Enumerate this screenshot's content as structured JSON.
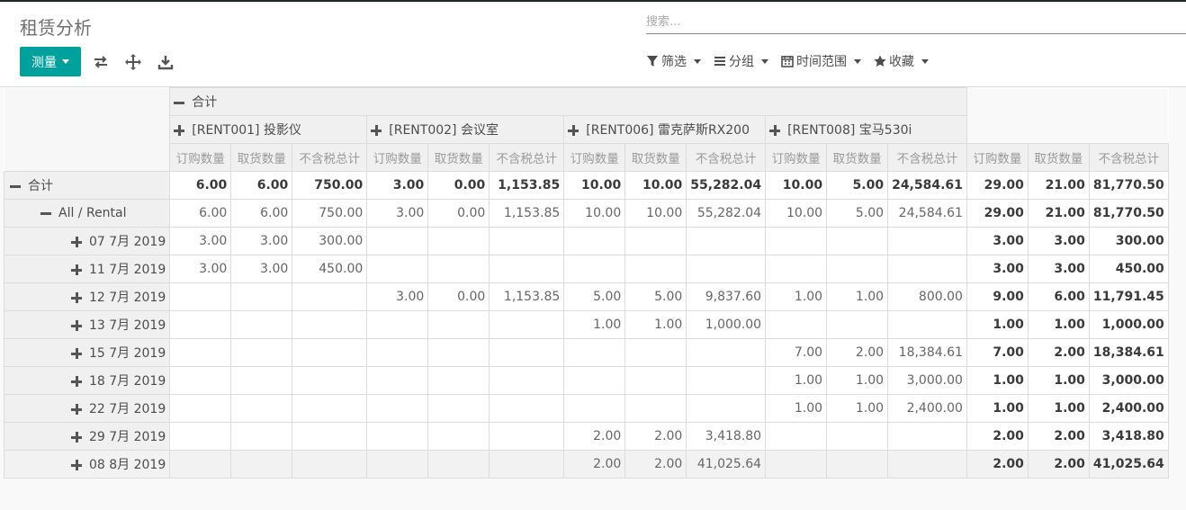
{
  "title": "租赁分析",
  "search": {
    "placeholder": "搜索..."
  },
  "toolbar": {
    "measure_label": "测量",
    "icons": [
      "flip-axis-icon",
      "expand-all-icon",
      "download-icon"
    ]
  },
  "filters": [
    {
      "label": "筛选",
      "icon": "filter-icon"
    },
    {
      "label": "分组",
      "icon": "group-icon"
    },
    {
      "label": "时间范围",
      "icon": "calendar-icon"
    },
    {
      "label": "收藏",
      "icon": "star-icon"
    }
  ],
  "pivot": {
    "col_total_label": "合计",
    "products": [
      "[RENT001] 投影仪",
      "[RENT002] 会议室",
      "[RENT006] 雷克萨斯RX200",
      "[RENT008] 宝马530i"
    ],
    "measures": [
      "订购数量",
      "取货数量",
      "不含税总计"
    ],
    "rows": [
      {
        "label": "合计",
        "level": 0,
        "sign": "minus",
        "cells": [
          "6.00",
          "6.00",
          "750.00",
          "3.00",
          "0.00",
          "1,153.85",
          "10.00",
          "10.00",
          "55,282.04",
          "10.00",
          "5.00",
          "24,584.61",
          "29.00",
          "21.00",
          "81,770.50"
        ]
      },
      {
        "label": "All / Rental",
        "level": 1,
        "sign": "minus",
        "cells": [
          "6.00",
          "6.00",
          "750.00",
          "3.00",
          "0.00",
          "1,153.85",
          "10.00",
          "10.00",
          "55,282.04",
          "10.00",
          "5.00",
          "24,584.61",
          "29.00",
          "21.00",
          "81,770.50"
        ]
      },
      {
        "label": "07 7月 2019",
        "level": 2,
        "sign": "plus",
        "cells": [
          "3.00",
          "3.00",
          "300.00",
          "",
          "",
          "",
          "",
          "",
          "",
          "",
          "",
          "",
          "3.00",
          "3.00",
          "300.00"
        ]
      },
      {
        "label": "11 7月 2019",
        "level": 2,
        "sign": "plus",
        "cells": [
          "3.00",
          "3.00",
          "450.00",
          "",
          "",
          "",
          "",
          "",
          "",
          "",
          "",
          "",
          "3.00",
          "3.00",
          "450.00"
        ]
      },
      {
        "label": "12 7月 2019",
        "level": 2,
        "sign": "plus",
        "cells": [
          "",
          "",
          "",
          "3.00",
          "0.00",
          "1,153.85",
          "5.00",
          "5.00",
          "9,837.60",
          "1.00",
          "1.00",
          "800.00",
          "9.00",
          "6.00",
          "11,791.45"
        ]
      },
      {
        "label": "13 7月 2019",
        "level": 2,
        "sign": "plus",
        "cells": [
          "",
          "",
          "",
          "",
          "",
          "",
          "1.00",
          "1.00",
          "1,000.00",
          "",
          "",
          "",
          "1.00",
          "1.00",
          "1,000.00"
        ]
      },
      {
        "label": "15 7月 2019",
        "level": 2,
        "sign": "plus",
        "cells": [
          "",
          "",
          "",
          "",
          "",
          "",
          "",
          "",
          "",
          "7.00",
          "2.00",
          "18,384.61",
          "7.00",
          "2.00",
          "18,384.61"
        ]
      },
      {
        "label": "18 7月 2019",
        "level": 2,
        "sign": "plus",
        "cells": [
          "",
          "",
          "",
          "",
          "",
          "",
          "",
          "",
          "",
          "1.00",
          "1.00",
          "3,000.00",
          "1.00",
          "1.00",
          "3,000.00"
        ]
      },
      {
        "label": "22 7月 2019",
        "level": 2,
        "sign": "plus",
        "cells": [
          "",
          "",
          "",
          "",
          "",
          "",
          "",
          "",
          "",
          "1.00",
          "1.00",
          "2,400.00",
          "1.00",
          "1.00",
          "2,400.00"
        ]
      },
      {
        "label": "29 7月 2019",
        "level": 2,
        "sign": "plus",
        "cells": [
          "",
          "",
          "",
          "",
          "",
          "",
          "2.00",
          "2.00",
          "3,418.80",
          "",
          "",
          "",
          "2.00",
          "2.00",
          "3,418.80"
        ]
      },
      {
        "label": "08 8月 2019",
        "level": 2,
        "sign": "plus",
        "cells": [
          "",
          "",
          "",
          "",
          "",
          "",
          "2.00",
          "2.00",
          "41,025.64",
          "",
          "",
          "",
          "2.00",
          "2.00",
          "41,025.64"
        ]
      }
    ]
  },
  "colors": {
    "accent": "#00a09d"
  }
}
